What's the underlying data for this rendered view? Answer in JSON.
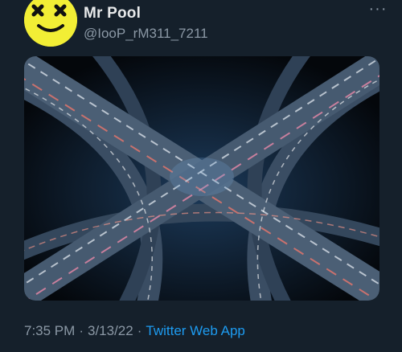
{
  "author": {
    "display_name": "Mr Pool",
    "handle": "@IooP_rM311_7211",
    "avatar_icon": "x-eyes-smiley-icon",
    "avatar_color": "#f2ee35"
  },
  "menu": {
    "more_icon": "more-horizontal-icon",
    "more_glyph": "···"
  },
  "media": {
    "subject": "aerial-night-highway-interchange"
  },
  "meta": {
    "time": "7:35 PM",
    "separator": "·",
    "date": "3/13/22",
    "source_app": "Twitter Web App"
  },
  "colors": {
    "background": "#15202b",
    "primary_text": "#e7e9ea",
    "secondary_text": "#8b98a5",
    "accent": "#1d9bf0"
  }
}
